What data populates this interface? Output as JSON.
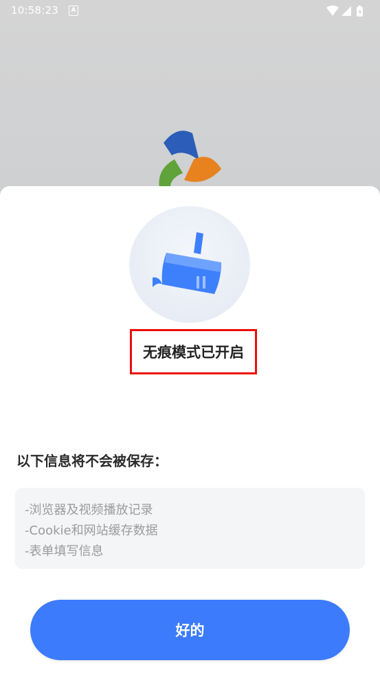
{
  "status_bar": {
    "time": "10:58:23",
    "notification_badge": "A",
    "icons": [
      "wifi-icon",
      "signal-icon",
      "battery-charging-icon"
    ]
  },
  "dialog": {
    "title": "无痕模式已开启",
    "section_title": "以下信息将不会被保存：",
    "items": [
      "-浏览器及视频播放记录",
      "-Cookie和网站缓存数据",
      "-表单填写信息"
    ],
    "confirm_button": "好的",
    "icon": "broom-icon"
  },
  "colors": {
    "accent": "#3C7BFB",
    "highlight_border": "#EE0B0B",
    "backdrop": "#C8CCD0"
  }
}
